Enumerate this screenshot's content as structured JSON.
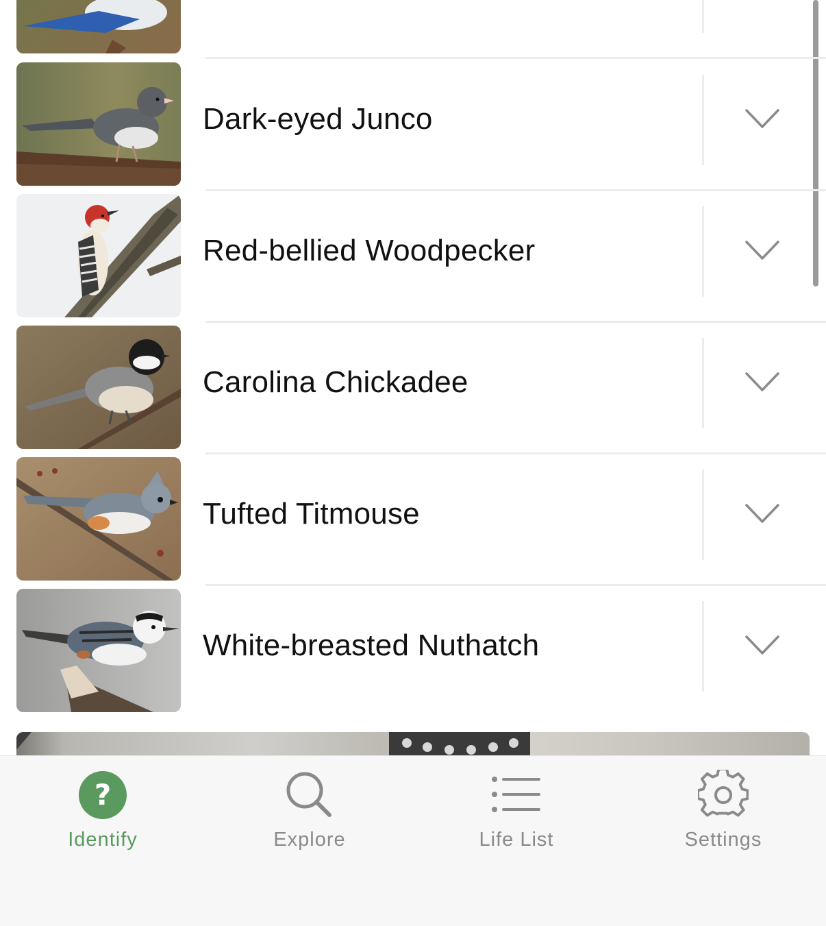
{
  "birds": [
    {
      "name": "Dark-eyed Junco"
    },
    {
      "name": "Red-bellied Woodpecker"
    },
    {
      "name": "Carolina Chickadee"
    },
    {
      "name": "Tufted Titmouse"
    },
    {
      "name": "White-breasted Nuthatch"
    }
  ],
  "tabs": [
    {
      "label": "Identify",
      "icon": "question-circle-icon",
      "active": true
    },
    {
      "label": "Explore",
      "icon": "search-icon",
      "active": false
    },
    {
      "label": "Life List",
      "icon": "list-icon",
      "active": false
    },
    {
      "label": "Settings",
      "icon": "gear-icon",
      "active": false
    }
  ],
  "colors": {
    "accent": "#5a9a5e",
    "inactive": "#8a8a8a",
    "separator": "#ececec",
    "tabbar_bg": "#f6f7f6"
  }
}
